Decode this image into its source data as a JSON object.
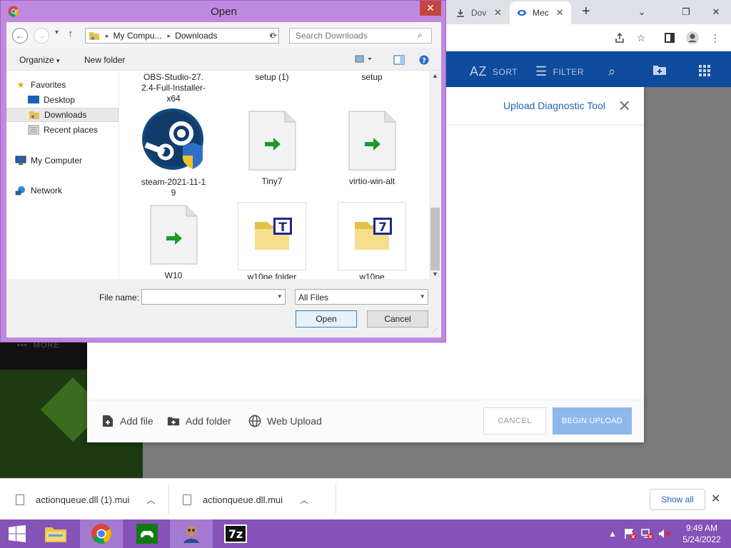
{
  "browser": {
    "tabs": [
      {
        "label": "Dov",
        "icon": "download-icon"
      },
      {
        "label": "Mec",
        "icon": "mega-logo-icon"
      }
    ],
    "new_tab_label": "+"
  },
  "app": {
    "sort_label": "SORT",
    "filter_label": "FILTER",
    "az_label": "AZ",
    "more_label": "MORE",
    "modal": {
      "title_link": "Upload Diagnostic Tool",
      "footer": {
        "add_file": "Add file",
        "add_folder": "Add folder",
        "web_upload": "Web Upload",
        "cancel": "CANCEL",
        "begin_upload": "BEGIN UPLOAD"
      }
    }
  },
  "downloads": {
    "items": [
      {
        "name": "actionqueue.dll (1).mui"
      },
      {
        "name": "actionqueue.dll.mui"
      }
    ],
    "show_all": "Show all"
  },
  "taskbar": {
    "time": "9:49 AM",
    "date": "5/24/2022",
    "apps": [
      "start",
      "file-explorer",
      "chrome",
      "xbox",
      "user-app",
      "7zip"
    ]
  },
  "dialog": {
    "title": "Open",
    "address": {
      "segments": [
        "My Compu...",
        "Downloads"
      ]
    },
    "search_placeholder": "Search Downloads",
    "commands": {
      "organize": "Organize",
      "new_folder": "New folder"
    },
    "nav": {
      "favorites": "Favorites",
      "desktop": "Desktop",
      "downloads": "Downloads",
      "recent": "Recent places",
      "my_computer": "My Computer",
      "network": "Network"
    },
    "files": [
      {
        "name": "OBS-Studio-27.2.4-Full-Installer-x64",
        "icon": "installer-icon"
      },
      {
        "name": "setup (1)",
        "icon": "installer-icon"
      },
      {
        "name": "setup",
        "icon": "installer-icon"
      },
      {
        "name": "steam-2021-11-19",
        "icon": "steam-icon"
      },
      {
        "name": "Tiny7",
        "icon": "shortcut-file-icon"
      },
      {
        "name": "virtio-win-alt",
        "icon": "shortcut-file-icon"
      },
      {
        "name": "W10",
        "icon": "shortcut-file-icon"
      },
      {
        "name": "w10pe.folder",
        "icon": "folder-t-icon"
      },
      {
        "name": "w10pe",
        "icon": "folder-7-icon"
      }
    ],
    "file_name_label": "File name:",
    "file_name_value": "",
    "file_type": "All Files",
    "open_button": "Open",
    "cancel_button": "Cancel"
  }
}
